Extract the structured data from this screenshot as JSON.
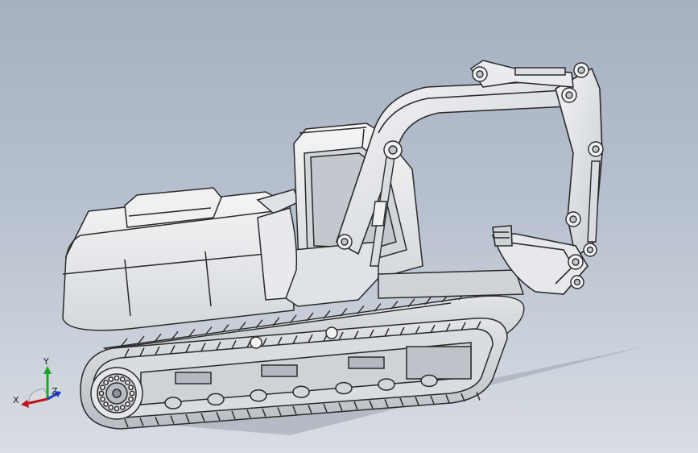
{
  "viewport": {
    "background_top": "#a6b0c0",
    "background_bottom": "#d9dde4",
    "model_fill": "#e9eaec",
    "model_shade": "#c9ccd1",
    "model_edge": "#2a2a2a"
  },
  "model": {
    "subject": "excavator",
    "icon": "excavator-icon"
  },
  "triad": {
    "x_label": "X",
    "y_label": "Y",
    "z_label": "Z",
    "x_color": "#c0141c",
    "y_color": "#1ea32a",
    "z_color": "#1a3fc8"
  }
}
